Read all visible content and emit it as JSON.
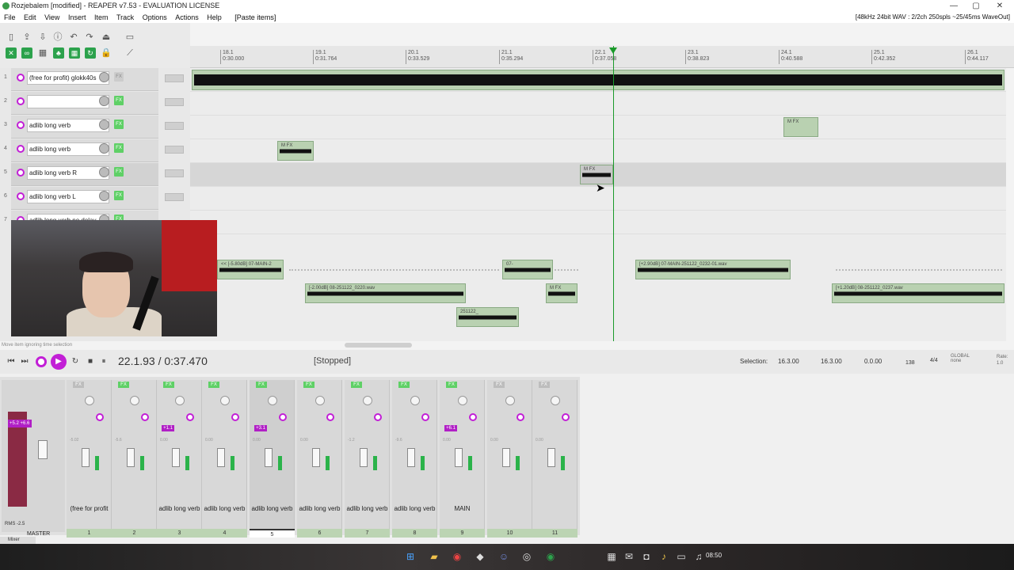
{
  "window": {
    "title": "Rozjebalem [modified] - REAPER v7.53 - EVALUATION LICENSE",
    "controls": [
      "—",
      "▢",
      "✕"
    ]
  },
  "menu": {
    "items": [
      "File",
      "Edit",
      "View",
      "Insert",
      "Item",
      "Track",
      "Options",
      "Actions",
      "Help",
      "[Paste items]"
    ],
    "sysinfo": "[48kHz 24bit WAV : 2/2ch 250spls ~25/45ms WaveOut]"
  },
  "ruler": {
    "marks": [
      {
        "bar": "18.1",
        "time": "0:30.000"
      },
      {
        "bar": "19.1",
        "time": "0:31.764"
      },
      {
        "bar": "20.1",
        "time": "0:33.529"
      },
      {
        "bar": "21.1",
        "time": "0:35.294"
      },
      {
        "bar": "22.1",
        "time": "0:37.058"
      },
      {
        "bar": "23.1",
        "time": "0:38.823"
      },
      {
        "bar": "24.1",
        "time": "0:40.588"
      },
      {
        "bar": "25.1",
        "time": "0:42.352"
      },
      {
        "bar": "26.1",
        "time": "0:44.117"
      }
    ]
  },
  "tracks": [
    {
      "num": "1",
      "name": "(free for profit) glokk40s"
    },
    {
      "num": "2",
      "name": ""
    },
    {
      "num": "3",
      "name": "adlib long verb"
    },
    {
      "num": "4",
      "name": "adlib long verb"
    },
    {
      "num": "5",
      "name": "adlib long verb R"
    },
    {
      "num": "6",
      "name": "adlib long verb L"
    },
    {
      "num": "7",
      "name": "adlib long verb no delay"
    }
  ],
  "items": {
    "lbl_a": "M FX",
    "lbl_b": "<< [-5.80dB] 07-MAIN-2",
    "lbl_c": "[-2.00dB] 08-251122_0220.wav",
    "lbl_d": "07-",
    "lbl_e": "[+2.90dB] 07-MAIN-251122_0232-01.wav",
    "lbl_f": "[+1.20dB] 08-251122_0237.wav",
    "lbl_g": "251122_",
    "fx_label": "FX"
  },
  "transport": {
    "time": "22.1.93 / 0:37.470",
    "state": "[Stopped]",
    "status_msg": "Move item ignoring time selection",
    "selection_label": "Selection:",
    "sel_start": "16.3.00",
    "sel_end": "16.3.00",
    "sel_len": "0.0.00",
    "tempo": "138",
    "timesig": "4/4",
    "global": "GLOBAL",
    "global_sub": "none",
    "rate_label": "Rate:",
    "rate_value": "1.0"
  },
  "mixer": {
    "master_label": "MASTER",
    "master_peak": "+5.2 +6.6",
    "rms_label": "RMS",
    "rms_value": "-2.5",
    "tab_label": "Mixer",
    "strips": [
      {
        "num": "1",
        "name": "(free for profit",
        "vol": "-5.02",
        "fx_on": false,
        "peak": ""
      },
      {
        "num": "2",
        "name": "",
        "vol": "-5.6",
        "fx_on": true,
        "peak": ""
      },
      {
        "num": "3",
        "name": "adlib long verb",
        "vol": "0.00",
        "fx_on": true,
        "peak": "+1.1"
      },
      {
        "num": "4",
        "name": "adlib long verb",
        "vol": "0.00",
        "fx_on": true,
        "peak": ""
      },
      {
        "num": "5",
        "name": "adlib long verb",
        "vol": "0.00",
        "fx_on": true,
        "peak": "+3.1"
      },
      {
        "num": "6",
        "name": "adlib long verb",
        "vol": "0.00",
        "fx_on": true,
        "peak": ""
      },
      {
        "num": "7",
        "name": "adlib long verb",
        "vol": "-1.2",
        "fx_on": true,
        "peak": ""
      },
      {
        "num": "8",
        "name": "adlib long verb",
        "vol": "-9.6",
        "fx_on": true,
        "peak": ""
      },
      {
        "num": "9",
        "name": "MAIN",
        "vol": "0.00",
        "fx_on": true,
        "peak": "+6.1"
      },
      {
        "num": "10",
        "name": "",
        "vol": "0.00",
        "fx_on": false,
        "peak": ""
      },
      {
        "num": "11",
        "name": "",
        "vol": "0.00",
        "fx_on": false,
        "peak": ""
      }
    ]
  },
  "taskbar": {
    "clock": "08:50"
  },
  "colors": {
    "accent": "#c21fd6",
    "item_green": "#b9d1b1",
    "playhead": "#1a9a2a"
  }
}
